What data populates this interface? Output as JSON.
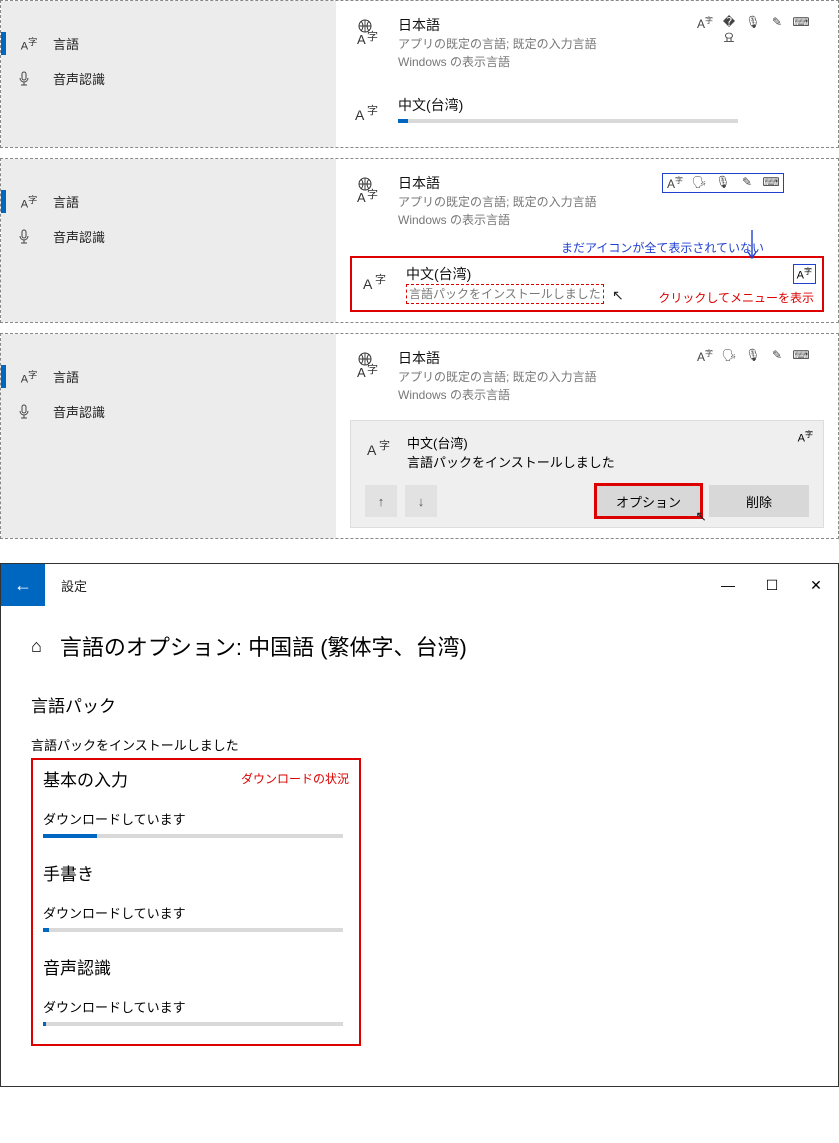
{
  "sidebar": {
    "items": [
      {
        "icon": "A字",
        "label": "言語"
      },
      {
        "icon": "🎤",
        "label": "音声認識"
      }
    ]
  },
  "panel1": {
    "japanese": {
      "title": "日本語",
      "sub1": "アプリの既定の言語; 既定の入力言語",
      "sub2": "Windows の表示言語"
    },
    "chinese": {
      "title": "中文(台湾)"
    }
  },
  "panel2": {
    "japanese": {
      "title": "日本語",
      "sub1": "アプリの既定の言語; 既定の入力言語",
      "sub2": "Windows の表示言語"
    },
    "chinese": {
      "title": "中文(台湾)",
      "status": "言語パックをインストールしました"
    },
    "anno_blue": "まだアイコンが全て表示されていない",
    "anno_red": "クリックしてメニューを表示"
  },
  "panel3": {
    "japanese": {
      "title": "日本語",
      "sub1": "アプリの既定の言語; 既定の入力言語",
      "sub2": "Windows の表示言語"
    },
    "chinese": {
      "title": "中文(台湾)",
      "status": "言語パックをインストールしました"
    },
    "buttons": {
      "options": "オプション",
      "remove": "削除"
    }
  },
  "options_window": {
    "title": "設定",
    "heading": "言語のオプション: 中国語 (繁体字、台湾)",
    "langpack_h": "言語パック",
    "langpack_status": "言語パックをインストールしました",
    "dl_anno": "ダウンロードの状況",
    "sections": [
      {
        "h": "基本の入力",
        "status": "ダウンロードしています",
        "pct": 18
      },
      {
        "h": "手書き",
        "status": "ダウンロードしています",
        "pct": 2
      },
      {
        "h": "音声認識",
        "status": "ダウンロードしています",
        "pct": 1
      }
    ]
  }
}
